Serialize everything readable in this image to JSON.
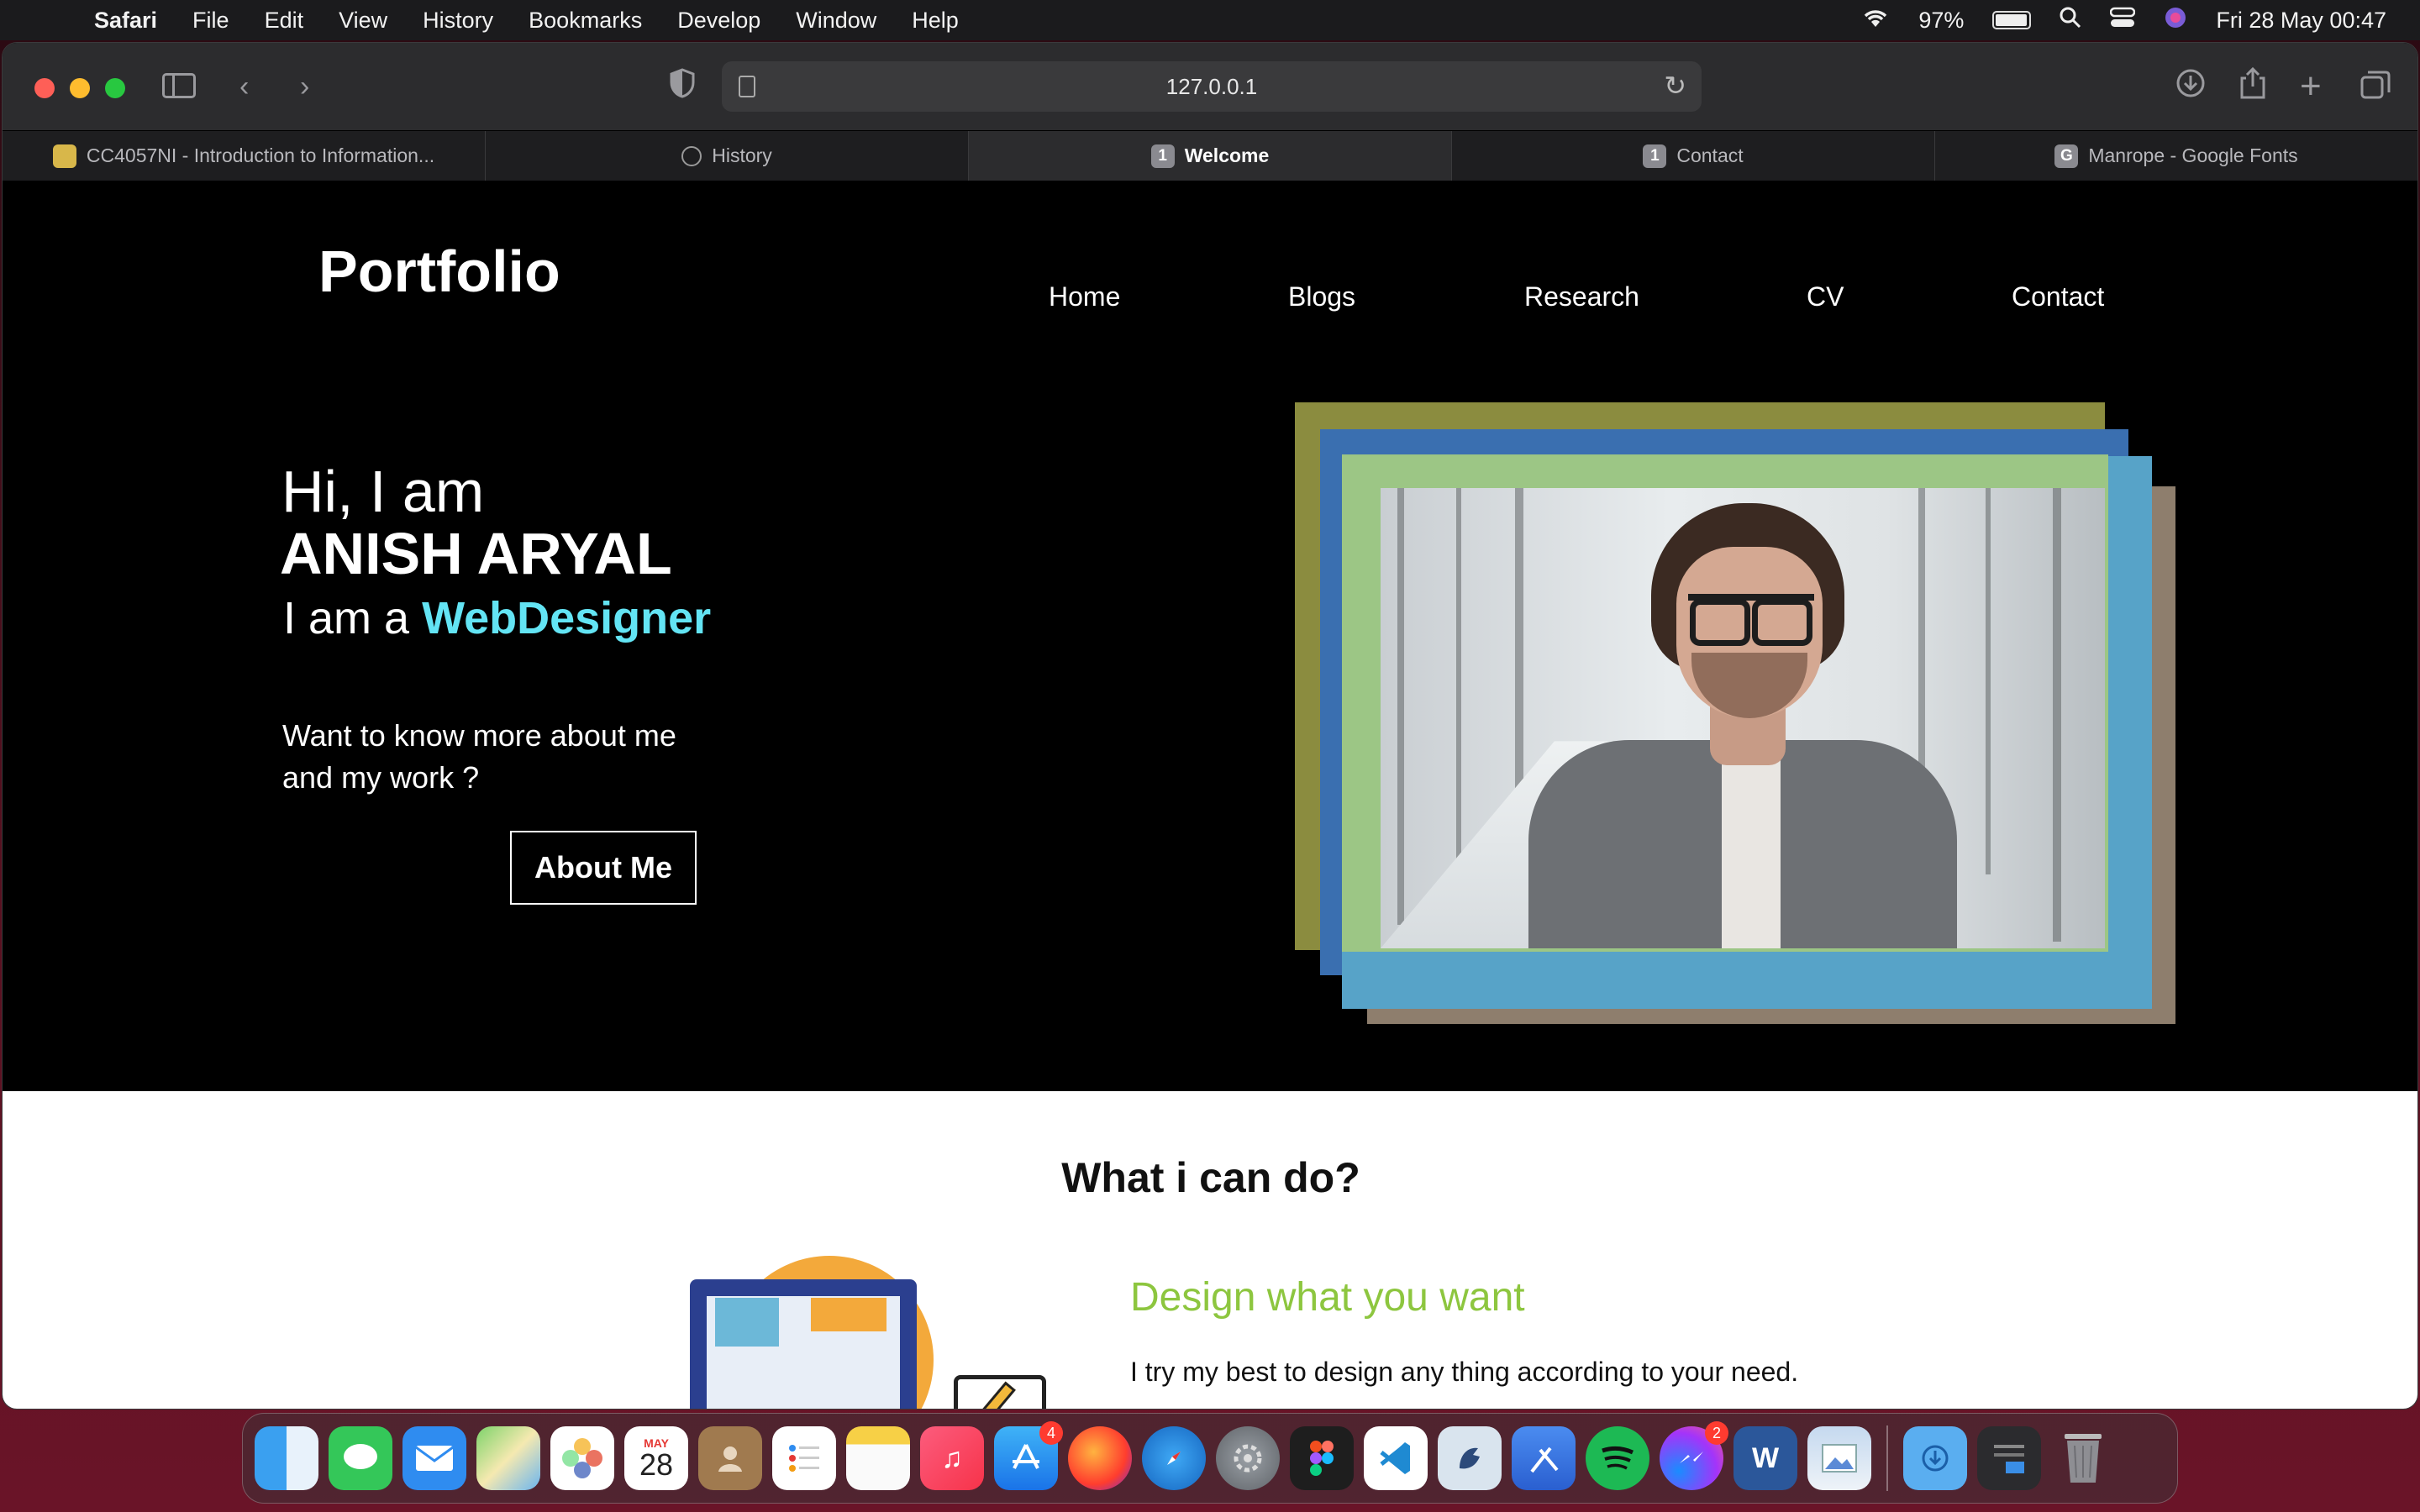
{
  "menubar": {
    "app": "Safari",
    "items": [
      "File",
      "Edit",
      "View",
      "History",
      "Bookmarks",
      "Develop",
      "Window",
      "Help"
    ],
    "battery": "97%",
    "clock": "Fri 28 May  00:47"
  },
  "browser": {
    "url": "127.0.0.1",
    "tabs": [
      {
        "title": "CC4057NI - Introduction to Information...",
        "favicon": ""
      },
      {
        "title": "History",
        "favicon": ""
      },
      {
        "title": "Welcome",
        "favicon": "1"
      },
      {
        "title": "Contact",
        "favicon": "1"
      },
      {
        "title": "Manrope - Google Fonts",
        "favicon": "G"
      }
    ],
    "active_tab": 2
  },
  "site": {
    "logo": "Portfolio",
    "nav": [
      "Home",
      "Blogs",
      "Research",
      "CV",
      "Contact"
    ],
    "hero": {
      "greeting": "Hi, I am",
      "name": "ANISH ARYAL",
      "role_prefix": "I am a",
      "role_highlight": "WebDesigner",
      "question": "Want to know more about me and my work ?",
      "button": "About Me",
      "accent_color": "#63e4f4"
    },
    "section": {
      "title": "What i can do?",
      "feature_title": "Design what you want",
      "feature_text": "I try my best to design any thing according to your need.",
      "feature_color": "#8dc63f"
    }
  },
  "dock": {
    "calendar_month": "MAY",
    "calendar_day": "28",
    "appstore_badge": "4",
    "messenger_badge": "2",
    "apps": [
      "finder-icon",
      "messages-icon",
      "mail-icon",
      "maps-icon",
      "photos-icon",
      "calendar-icon",
      "contacts-icon",
      "reminders-icon",
      "notes-icon",
      "music-icon",
      "app-store-icon",
      "firefox-icon",
      "safari-icon",
      "system-preferences-icon",
      "figma-icon",
      "vscode-icon",
      "cyberduck-icon",
      "xcode-icon",
      "spotify-icon",
      "messenger-icon",
      "word-icon",
      "preview-icon",
      "downloads-folder-icon",
      "recents-stack-icon",
      "trash-icon"
    ]
  }
}
